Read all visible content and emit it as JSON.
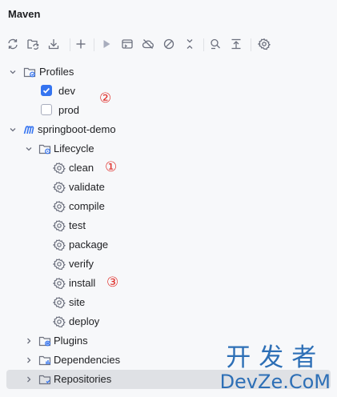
{
  "window": {
    "title": "Maven"
  },
  "toolbar": {
    "buttons": [
      {
        "name": "reload-all-projects-icon"
      },
      {
        "name": "reload-project-icon"
      },
      {
        "name": "download-sources-icon"
      },
      {
        "name": "add-maven-project-icon"
      },
      {
        "name": "run-maven-build-icon"
      },
      {
        "name": "execute-maven-goal-icon"
      },
      {
        "name": "toggle-offline-mode-icon"
      },
      {
        "name": "skip-tests-icon"
      },
      {
        "name": "collapse-all-icon"
      },
      {
        "name": "analyze-dependencies-icon"
      },
      {
        "name": "show-dependencies-icon"
      },
      {
        "name": "maven-settings-icon"
      }
    ]
  },
  "tree": {
    "profiles": {
      "label": "Profiles",
      "items": [
        {
          "label": "dev",
          "checked": true
        },
        {
          "label": "prod",
          "checked": false
        }
      ],
      "annotation": "②"
    },
    "project": {
      "label": "springboot-demo",
      "lifecycle": {
        "label": "Lifecycle",
        "goals": [
          "clean",
          "validate",
          "compile",
          "test",
          "package",
          "verify",
          "install",
          "site",
          "deploy"
        ]
      },
      "plugins": {
        "label": "Plugins"
      },
      "dependencies": {
        "label": "Dependencies"
      },
      "repositories": {
        "label": "Repositories"
      }
    },
    "annotations": {
      "clean": "①",
      "install": "③"
    }
  },
  "watermark": {
    "line1": "开发者",
    "line2": "DevZe.CoM"
  },
  "colors": {
    "background": "#f7f8fa",
    "selection": "#dfe1e5",
    "accent": "#3574f0",
    "annotation": "#e0302b",
    "watermark": "#2d6fb6",
    "icon": "#6c707e"
  }
}
